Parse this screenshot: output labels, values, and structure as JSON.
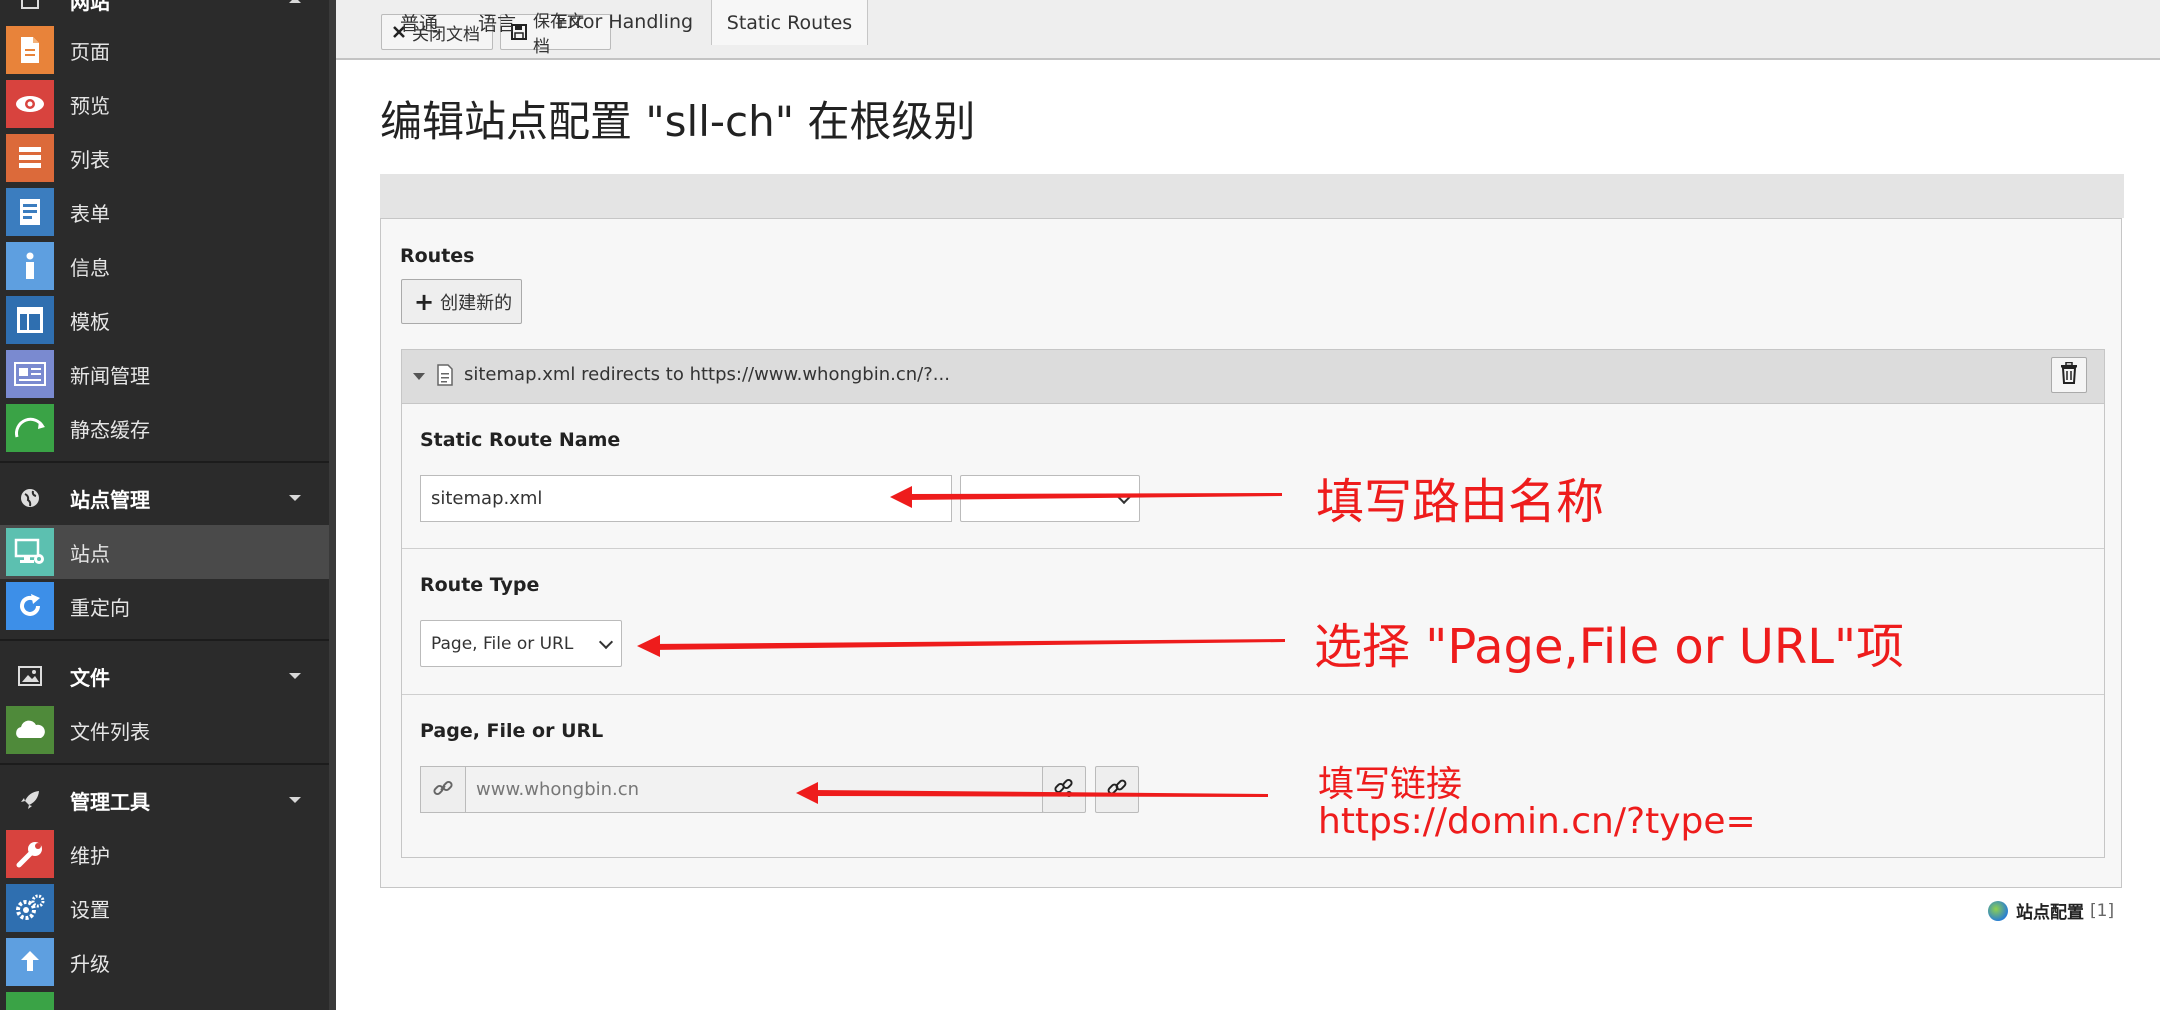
{
  "sidebar": {
    "top_group_label": "网站",
    "items": [
      {
        "label": "页面",
        "icon": "page-icon",
        "color": "#e8833a"
      },
      {
        "label": "预览",
        "icon": "eye-icon",
        "color": "#d8433e"
      },
      {
        "label": "列表",
        "icon": "list-icon",
        "color": "#dc6a3a"
      },
      {
        "label": "表单",
        "icon": "form-icon",
        "color": "#3b7dbf"
      },
      {
        "label": "信息",
        "icon": "info-icon",
        "color": "#5e9fe0"
      },
      {
        "label": "模板",
        "icon": "template-icon",
        "color": "#2f6fb0"
      },
      {
        "label": "新闻管理",
        "icon": "news-icon",
        "color": "#7a8ad0"
      },
      {
        "label": "静态缓存",
        "icon": "gauge-icon",
        "color": "#3aa346"
      }
    ],
    "site_group": {
      "label": "站点管理",
      "icon": "globe-icon"
    },
    "site_items": [
      {
        "label": "站点",
        "icon": "sites-icon",
        "color": "#5cc0b0",
        "active": true
      },
      {
        "label": "重定向",
        "icon": "redirect-icon",
        "color": "#3d8fe8"
      }
    ],
    "file_group": {
      "label": "文件",
      "icon": "image-icon"
    },
    "file_items": [
      {
        "label": "文件列表",
        "icon": "files-icon",
        "color": "#4f8a3a"
      }
    ],
    "tools_group": {
      "label": "管理工具",
      "icon": "rocket-icon"
    },
    "tools_items": [
      {
        "label": "维护",
        "icon": "wrench-icon",
        "color": "#d8433e"
      },
      {
        "label": "设置",
        "icon": "cogs-icon",
        "color": "#2f6fb0"
      },
      {
        "label": "升级",
        "icon": "upgrade-icon",
        "color": "#5e9fe0"
      }
    ]
  },
  "toolbar": {
    "close_label": "关闭文档",
    "save_label": "保存文档"
  },
  "page": {
    "title": "编辑站点配置 \"sll-ch\" 在根级别"
  },
  "tabs": [
    {
      "label": "普通"
    },
    {
      "label": "语言"
    },
    {
      "label": "Error Handling"
    },
    {
      "label": "Static Routes",
      "active": true
    }
  ],
  "routes": {
    "label": "Routes",
    "create_label": "创建新的",
    "record_title": "sitemap.xml redirects to https://www.whongbin.cn/?...",
    "name_label": "Static Route Name",
    "name_value": "sitemap.xml",
    "name_select_value": "",
    "type_label": "Route Type",
    "type_value": "Page, File or URL",
    "link_label": "Page, File or URL",
    "link_value": "www.whongbin.cn"
  },
  "annotations": {
    "a1": "填写路由名称",
    "a2": "选择 \"Page,File or URL\"项",
    "a3_line1": "填写链接",
    "a3_line2": "https://domin.cn/?type=",
    "color": "#ee1c1c"
  },
  "footer": {
    "label": "站点配置",
    "count": "[1]"
  }
}
